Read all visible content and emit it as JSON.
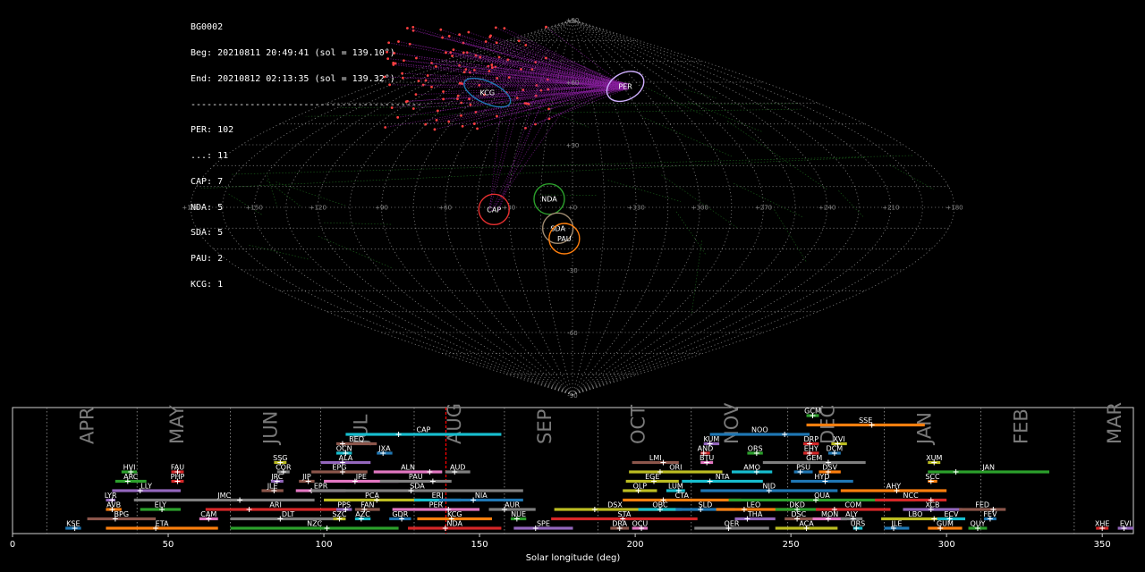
{
  "info": {
    "id": "BG0002",
    "beg": "Beg: 20210811 20:49:41 (sol = 139.10°)",
    "end": "End: 20210812 02:13:35 (sol = 139.32°)",
    "sep": "-------------------------------------------",
    "counts": [
      "PER: 102",
      "...: 11",
      "CAP: 7",
      "NDA: 5",
      "SDA: 5",
      "PAU: 2",
      "KCG: 1"
    ]
  },
  "colors": {
    "grid": "#b0b0b0",
    "line": "#888888",
    "marker": "#ff0000",
    "per": "#ff4040",
    "cap": "#e83030",
    "nda": "#2ca02c",
    "sda": "#9f8a70",
    "pau": "#ff7f0e",
    "kcg": "#1f77b4"
  },
  "sky_map": {
    "projection": "sinusoidal",
    "lon_ticks": [
      "+180",
      "+150",
      "+120",
      "+90",
      "+60",
      "+30",
      "+0",
      "+330",
      "+300",
      "+270",
      "+240",
      "+210",
      "+180"
    ],
    "lat_ticks": [
      "+90",
      "+60",
      "+30",
      "-30",
      "-60",
      "-90"
    ],
    "radiants": [
      {
        "code": "PER",
        "lon": 47,
        "lat": 58,
        "color": "#ff4040",
        "circle": "#d0b0ff"
      },
      {
        "code": "KCG",
        "lon": 290,
        "lat": 55,
        "color": "#ffffff",
        "circle": "#1f77b4"
      },
      {
        "code": "NDA",
        "lon": 349,
        "lat": 4,
        "color": "#ffffff",
        "circle": "#2ca02c"
      },
      {
        "code": "CAP",
        "lon": 323,
        "lat": -1,
        "color": "#ff2020",
        "circle": "#e83030"
      },
      {
        "code": "SDA",
        "lon": 353,
        "lat": -10,
        "color": "#ffffff",
        "circle": "#9f8a70"
      },
      {
        "code": "PAU",
        "lon": 356,
        "lat": -15,
        "color": "#ffffff",
        "circle": "#ff7f0e"
      }
    ]
  },
  "chart_data": {
    "type": "gantt",
    "xlabel": "Solar longitude (deg)",
    "xlim": [
      0,
      360
    ],
    "xticks": [
      0,
      50,
      100,
      150,
      200,
      250,
      300,
      350
    ],
    "current_sol": 139.2,
    "months": [
      {
        "label": "APR",
        "sol": 11
      },
      {
        "label": "MAY",
        "sol": 40
      },
      {
        "label": "JUN",
        "sol": 70
      },
      {
        "label": "JUL",
        "sol": 99
      },
      {
        "label": "AUG",
        "sol": 129
      },
      {
        "label": "SEP",
        "sol": 158
      },
      {
        "label": "OCT",
        "sol": 188
      },
      {
        "label": "NOV",
        "sol": 218
      },
      {
        "label": "DEC",
        "sol": 249
      },
      {
        "label": "JAN",
        "sol": 280
      },
      {
        "label": "FEB",
        "sol": 311
      },
      {
        "label": "MAR",
        "sol": 341
      }
    ],
    "showers": [
      {
        "code": "GCM",
        "start": 255,
        "end": 259,
        "peak": 257,
        "row": 12,
        "color": "#2ca02c"
      },
      {
        "code": "SSE",
        "start": 255,
        "end": 293,
        "peak": 276,
        "row": 11,
        "color": "#ff7f0e"
      },
      {
        "code": "NOO",
        "start": 224,
        "end": 256,
        "peak": 248,
        "row": 10,
        "color": "#1f77b4"
      },
      {
        "code": "CAP",
        "start": 107,
        "end": 157,
        "peak": 124,
        "row": 10,
        "color": "#17becf"
      },
      {
        "code": "KUM",
        "start": 222,
        "end": 227,
        "peak": 224,
        "row": 9,
        "color": "#9467bd"
      },
      {
        "code": "DRP",
        "start": 254,
        "end": 259,
        "peak": 256,
        "row": 9,
        "color": "#d62728"
      },
      {
        "code": "XVI",
        "start": 263,
        "end": 268,
        "peak": 265,
        "row": 9,
        "color": "#bcbd22"
      },
      {
        "code": "BEQ",
        "start": 104,
        "end": 117,
        "peak": 106,
        "row": 9,
        "color": "#8c564b"
      },
      {
        "code": "AND",
        "start": 221,
        "end": 224,
        "peak": 222,
        "row": 8,
        "color": "#d62728"
      },
      {
        "code": "ORS",
        "start": 236,
        "end": 241,
        "peak": 239,
        "row": 8,
        "color": "#2ca02c"
      },
      {
        "code": "EHY",
        "start": 254,
        "end": 259,
        "peak": 256,
        "row": 8,
        "color": "#d62728"
      },
      {
        "code": "DCM",
        "start": 262,
        "end": 266,
        "peak": 264,
        "row": 8,
        "color": "#1f77b4"
      },
      {
        "code": "OCN",
        "start": 104,
        "end": 109,
        "peak": 107,
        "row": 8,
        "color": "#17becf"
      },
      {
        "code": "JXA",
        "start": 117,
        "end": 122,
        "peak": 119,
        "row": 8,
        "color": "#1f77b4"
      },
      {
        "code": "LMI",
        "start": 199,
        "end": 214,
        "peak": 209,
        "row": 7,
        "color": "#8c564b"
      },
      {
        "code": "BTU",
        "start": 221,
        "end": 225,
        "peak": 223,
        "row": 7,
        "color": "#e377c2"
      },
      {
        "code": "GEM",
        "start": 241,
        "end": 274,
        "peak": 262,
        "row": 7,
        "color": "#7f7f7f"
      },
      {
        "code": "XUM",
        "start": 294,
        "end": 298,
        "peak": 296,
        "row": 7,
        "color": "#bcbd22"
      },
      {
        "code": "SSG",
        "start": 84,
        "end": 88,
        "peak": 86,
        "row": 7,
        "color": "#bcbd22"
      },
      {
        "code": "ALA",
        "start": 99,
        "end": 115,
        "peak": 106,
        "row": 7,
        "color": "#9467bd"
      },
      {
        "code": "HVI",
        "start": 35,
        "end": 40,
        "peak": 38,
        "row": 6,
        "color": "#2ca02c"
      },
      {
        "code": "FAU",
        "start": 51,
        "end": 55,
        "peak": 53,
        "row": 6,
        "color": "#d62728"
      },
      {
        "code": "COR",
        "start": 85,
        "end": 89,
        "peak": 87,
        "row": 6,
        "color": "#7f7f7f"
      },
      {
        "code": "EPG",
        "start": 96,
        "end": 114,
        "peak": 106,
        "row": 6,
        "color": "#8c564b"
      },
      {
        "code": "ALN",
        "start": 116,
        "end": 138,
        "peak": 134,
        "row": 6,
        "color": "#e377c2"
      },
      {
        "code": "AUD",
        "start": 139,
        "end": 147,
        "peak": 142,
        "row": 6,
        "color": "#7f7f7f"
      },
      {
        "code": "ORI",
        "start": 198,
        "end": 228,
        "peak": 208,
        "row": 6,
        "color": "#bcbd22"
      },
      {
        "code": "AMO",
        "start": 231,
        "end": 244,
        "peak": 239,
        "row": 6,
        "color": "#17becf"
      },
      {
        "code": "PSU",
        "start": 251,
        "end": 257,
        "peak": 253,
        "row": 6,
        "color": "#1f77b4"
      },
      {
        "code": "DSV",
        "start": 259,
        "end": 266,
        "peak": 262,
        "row": 6,
        "color": "#ff7f0e"
      },
      {
        "code": "JAN",
        "start": 294,
        "end": 333,
        "peak": 303,
        "row": 6,
        "color": "#2ca02c"
      },
      {
        "code": "ARC",
        "start": 33,
        "end": 43,
        "peak": 37,
        "row": 5,
        "color": "#2ca02c"
      },
      {
        "code": "PHP",
        "start": 51,
        "end": 55,
        "peak": 53,
        "row": 5,
        "color": "#d62728"
      },
      {
        "code": "JRC",
        "start": 83,
        "end": 87,
        "peak": 85,
        "row": 5,
        "color": "#9467bd"
      },
      {
        "code": "JIP",
        "start": 92,
        "end": 97,
        "peak": 95,
        "row": 5,
        "color": "#8c564b"
      },
      {
        "code": "JPE",
        "start": 100,
        "end": 124,
        "peak": 110,
        "row": 5,
        "color": "#e377c2"
      },
      {
        "code": "PAU",
        "start": 118,
        "end": 141,
        "peak": 135,
        "row": 5,
        "color": "#7f7f7f"
      },
      {
        "code": "EGE",
        "start": 197,
        "end": 214,
        "peak": 206,
        "row": 5,
        "color": "#bcbd22"
      },
      {
        "code": "NTA",
        "start": 215,
        "end": 241,
        "peak": 224,
        "row": 5,
        "color": "#17becf"
      },
      {
        "code": "HYD",
        "start": 250,
        "end": 270,
        "peak": 261,
        "row": 5,
        "color": "#1f77b4"
      },
      {
        "code": "SCC",
        "start": 294,
        "end": 297,
        "peak": 295,
        "row": 5,
        "color": "#ff7f0e"
      },
      {
        "code": "LLY",
        "start": 32,
        "end": 54,
        "peak": 41,
        "row": 4,
        "color": "#9467bd"
      },
      {
        "code": "JLE",
        "start": 80,
        "end": 87,
        "peak": 84,
        "row": 4,
        "color": "#8c564b"
      },
      {
        "code": "EPR",
        "start": 91,
        "end": 107,
        "peak": 96,
        "row": 4,
        "color": "#e377c2"
      },
      {
        "code": "SDA",
        "start": 96,
        "end": 164,
        "peak": 128,
        "row": 4,
        "color": "#7f7f7f"
      },
      {
        "code": "OLP",
        "start": 196,
        "end": 207,
        "peak": 201,
        "row": 4,
        "color": "#bcbd22"
      },
      {
        "code": "LUM",
        "start": 210,
        "end": 216,
        "peak": 214,
        "row": 4,
        "color": "#17becf"
      },
      {
        "code": "NID",
        "start": 221,
        "end": 265,
        "peak": 243,
        "row": 4,
        "color": "#1f77b4"
      },
      {
        "code": "AHY",
        "start": 266,
        "end": 300,
        "peak": 284,
        "row": 4,
        "color": "#ff7f0e"
      },
      {
        "code": "LYR",
        "start": 30,
        "end": 33,
        "peak": 32,
        "row": 3,
        "color": "#9467bd"
      },
      {
        "code": "JMC",
        "start": 39,
        "end": 97,
        "peak": 73,
        "row": 3,
        "color": "#7f7f7f"
      },
      {
        "code": "PCA",
        "start": 100,
        "end": 131,
        "peak": 117,
        "row": 3,
        "color": "#bcbd22"
      },
      {
        "code": "ERI",
        "start": 129,
        "end": 144,
        "peak": 138,
        "row": 3,
        "color": "#17becf"
      },
      {
        "code": "NIA",
        "start": 137,
        "end": 164,
        "peak": 148,
        "row": 3,
        "color": "#1f77b4"
      },
      {
        "code": "CTA",
        "start": 196,
        "end": 234,
        "peak": 209,
        "row": 3,
        "color": "#ff7f0e"
      },
      {
        "code": "QUA",
        "start": 230,
        "end": 290,
        "peak": 258,
        "row": 3,
        "color": "#2ca02c"
      },
      {
        "code": "NCC",
        "start": 277,
        "end": 300,
        "peak": 295,
        "row": 3,
        "color": "#d62728"
      },
      {
        "code": "AVB",
        "start": 30,
        "end": 35,
        "peak": 32,
        "row": 2,
        "color": "#ff7f0e"
      },
      {
        "code": "ELY",
        "start": 41,
        "end": 54,
        "peak": 48,
        "row": 2,
        "color": "#2ca02c"
      },
      {
        "code": "ARI",
        "start": 62,
        "end": 107,
        "peak": 76,
        "row": 2,
        "color": "#d62728"
      },
      {
        "code": "PPS",
        "start": 104,
        "end": 109,
        "peak": 107,
        "row": 2,
        "color": "#9467bd"
      },
      {
        "code": "FAN",
        "start": 110,
        "end": 118,
        "peak": 113,
        "row": 2,
        "color": "#8c564b"
      },
      {
        "code": "PER",
        "start": 122,
        "end": 150,
        "peak": 140,
        "row": 2,
        "color": "#e377c2"
      },
      {
        "code": "AUR",
        "start": 153,
        "end": 168,
        "peak": 158,
        "row": 2,
        "color": "#7f7f7f"
      },
      {
        "code": "DSX",
        "start": 174,
        "end": 213,
        "peak": 187,
        "row": 2,
        "color": "#bcbd22"
      },
      {
        "code": "OBC",
        "start": 201,
        "end": 215,
        "peak": 208,
        "row": 2,
        "color": "#17becf"
      },
      {
        "code": "SLD",
        "start": 213,
        "end": 232,
        "peak": 221,
        "row": 2,
        "color": "#1f77b4"
      },
      {
        "code": "LEO",
        "start": 226,
        "end": 250,
        "peak": 235,
        "row": 2,
        "color": "#ff7f0e"
      },
      {
        "code": "DKD",
        "start": 245,
        "end": 259,
        "peak": 252,
        "row": 2,
        "color": "#2ca02c"
      },
      {
        "code": "COM",
        "start": 258,
        "end": 282,
        "peak": 264,
        "row": 2,
        "color": "#d62728"
      },
      {
        "code": "XCB",
        "start": 286,
        "end": 305,
        "peak": 295,
        "row": 2,
        "color": "#9467bd"
      },
      {
        "code": "FED",
        "start": 304,
        "end": 319,
        "peak": 315,
        "row": 2,
        "color": "#8c564b"
      },
      {
        "code": "BPG",
        "start": 24,
        "end": 46,
        "peak": 33,
        "row": 1,
        "color": "#8c564b"
      },
      {
        "code": "CAM",
        "start": 60,
        "end": 66,
        "peak": 63,
        "row": 1,
        "color": "#e377c2"
      },
      {
        "code": "DLT",
        "start": 70,
        "end": 107,
        "peak": 86,
        "row": 1,
        "color": "#7f7f7f"
      },
      {
        "code": "SZC",
        "start": 103,
        "end": 107,
        "peak": 105,
        "row": 1,
        "color": "#bcbd22"
      },
      {
        "code": "AZC",
        "start": 110,
        "end": 115,
        "peak": 112,
        "row": 1,
        "color": "#17becf"
      },
      {
        "code": "GDR",
        "start": 121,
        "end": 128,
        "peak": 125,
        "row": 1,
        "color": "#1f77b4"
      },
      {
        "code": "KCG",
        "start": 130,
        "end": 154,
        "peak": 141,
        "row": 1,
        "color": "#ff7f0e"
      },
      {
        "code": "NUE",
        "start": 160,
        "end": 165,
        "peak": 162,
        "row": 1,
        "color": "#2ca02c"
      },
      {
        "code": "STA",
        "start": 173,
        "end": 220,
        "peak": 196,
        "row": 1,
        "color": "#d62728"
      },
      {
        "code": "THA",
        "start": 232,
        "end": 245,
        "peak": 236,
        "row": 1,
        "color": "#9467bd"
      },
      {
        "code": "DSC",
        "start": 248,
        "end": 257,
        "peak": 252,
        "row": 1,
        "color": "#8c564b"
      },
      {
        "code": "MON",
        "start": 257,
        "end": 268,
        "peak": 262,
        "row": 1,
        "color": "#e377c2"
      },
      {
        "code": "ALY",
        "start": 266,
        "end": 273,
        "peak": 270,
        "row": 1,
        "color": "#7f7f7f"
      },
      {
        "code": "LBO",
        "start": 279,
        "end": 301,
        "peak": 296,
        "row": 1,
        "color": "#bcbd22"
      },
      {
        "code": "ECV",
        "start": 297,
        "end": 306,
        "peak": 301,
        "row": 1,
        "color": "#17becf"
      },
      {
        "code": "FEV",
        "start": 312,
        "end": 316,
        "peak": 314,
        "row": 1,
        "color": "#1f77b4"
      },
      {
        "code": "KSE",
        "start": 17,
        "end": 22,
        "peak": 20,
        "row": 0,
        "color": "#1f77b4"
      },
      {
        "code": "ETA",
        "start": 30,
        "end": 66,
        "peak": 46,
        "row": 0,
        "color": "#ff7f0e"
      },
      {
        "code": "NZC",
        "start": 70,
        "end": 124,
        "peak": 101,
        "row": 0,
        "color": "#2ca02c"
      },
      {
        "code": "NDA",
        "start": 127,
        "end": 157,
        "peak": 139,
        "row": 0,
        "color": "#d62728"
      },
      {
        "code": "SPE",
        "start": 161,
        "end": 180,
        "peak": 168,
        "row": 0,
        "color": "#9467bd"
      },
      {
        "code": "DRA",
        "start": 192,
        "end": 198,
        "peak": 195,
        "row": 0,
        "color": "#8c564b"
      },
      {
        "code": "OCU",
        "start": 199,
        "end": 204,
        "peak": 202,
        "row": 0,
        "color": "#e377c2"
      },
      {
        "code": "OER",
        "start": 219,
        "end": 243,
        "peak": 230,
        "row": 0,
        "color": "#7f7f7f"
      },
      {
        "code": "ACA",
        "start": 245,
        "end": 265,
        "peak": 255,
        "row": 0,
        "color": "#bcbd22"
      },
      {
        "code": "URS",
        "start": 270,
        "end": 273,
        "peak": 271,
        "row": 0,
        "color": "#17becf"
      },
      {
        "code": "JLE",
        "start": 280,
        "end": 288,
        "peak": 283,
        "row": 0,
        "color": "#1f77b4"
      },
      {
        "code": "GUM",
        "start": 294,
        "end": 305,
        "peak": 298,
        "row": 0,
        "color": "#ff7f0e"
      },
      {
        "code": "QUY",
        "start": 307,
        "end": 313,
        "peak": 310,
        "row": 0,
        "color": "#2ca02c"
      },
      {
        "code": "XHE",
        "start": 348,
        "end": 352,
        "peak": 350,
        "row": 0,
        "color": "#d62728"
      },
      {
        "code": "EVI",
        "start": 355,
        "end": 360,
        "peak": 357,
        "row": 0,
        "color": "#9467bd"
      }
    ]
  }
}
